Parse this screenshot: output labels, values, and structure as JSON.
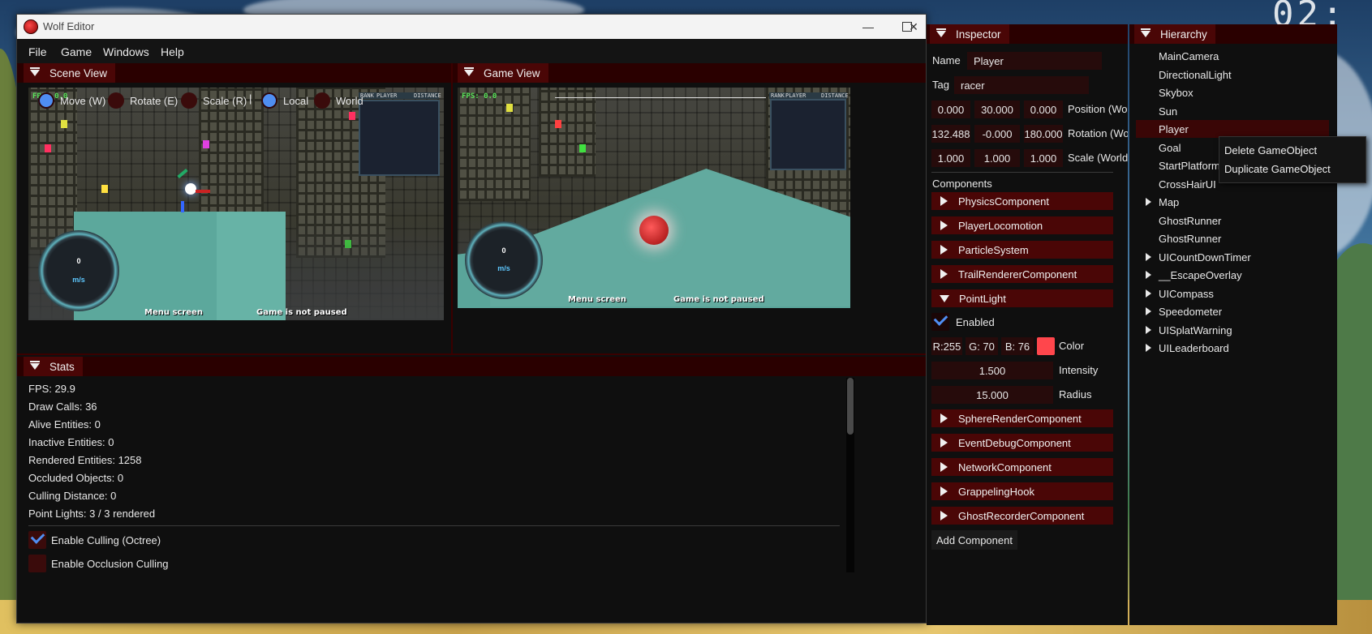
{
  "window": {
    "title": "Wolf Editor"
  },
  "clock": "02:",
  "menu": [
    "File",
    "Game",
    "Windows",
    "Help"
  ],
  "scene_view": {
    "title": "Scene View",
    "gizmo": [
      {
        "label": "Move (W)",
        "active": true
      },
      {
        "label": "Rotate (E)",
        "active": false
      },
      {
        "label": "Scale (R)",
        "active": false
      },
      {
        "label": "Local",
        "active": true
      },
      {
        "label": "World",
        "active": false
      }
    ],
    "separator": "|",
    "hud": {
      "fps": "FPS: 0.0",
      "rank": "RANK",
      "player": "PLAYER",
      "distance": "DISTANCE",
      "speed": "0",
      "unit": "m/s",
      "menu": "Menu screen",
      "paused": "Game is not paused"
    }
  },
  "game_view": {
    "title": "Game View",
    "hud": {
      "fps": "FPS: 0.0",
      "rank": "RANK",
      "player": "PLAYER",
      "distance": "DISTANCE",
      "speed": "0",
      "unit": "m/s",
      "menu": "Menu screen",
      "paused": "Game is not paused"
    }
  },
  "stats": {
    "title": "Stats",
    "lines": [
      "FPS: 29.9",
      "Draw Calls: 36",
      "Alive Entities: 0",
      "Inactive Entities: 0",
      "Rendered Entities: 1258",
      "Occluded Objects: 0",
      "Culling Distance: 0",
      "Point Lights: 3 / 3 rendered"
    ],
    "enable_culling": {
      "label": "Enable Culling (Octree)",
      "checked": true
    },
    "enable_occlusion": {
      "label": "Enable Occlusion Culling",
      "checked": false
    }
  },
  "inspector": {
    "title": "Inspector",
    "name_label": "Name",
    "name_value": "Player",
    "tag_label": "Tag",
    "tag_value": "racer",
    "position": {
      "x": "0.000",
      "y": "30.000",
      "z": "0.000",
      "label": "Position (World)"
    },
    "rotation": {
      "x": "132.488",
      "y": "-0.000",
      "z": "180.000",
      "label": "Rotation (World)"
    },
    "scale": {
      "x": "1.000",
      "y": "1.000",
      "z": "1.000",
      "label": "Scale (World)"
    },
    "components_label": "Components",
    "components_before": [
      "PhysicsComponent",
      "PlayerLocomotion",
      "ParticleSystem",
      "TrailRendererComponent"
    ],
    "point_light": {
      "name": "PointLight",
      "enabled_label": "Enabled",
      "enabled": true,
      "r": "R:255",
      "g": "G: 70",
      "b": "B: 76",
      "color_label": "Color",
      "color_hex": "#ff464c",
      "intensity": "1.500",
      "intensity_label": "Intensity",
      "radius": "15.000",
      "radius_label": "Radius"
    },
    "components_after": [
      "SphereRenderComponent",
      "EventDebugComponent",
      "NetworkComponent",
      "GrappelingHook",
      "GhostRecorderComponent"
    ],
    "add_component": "Add Component"
  },
  "hierarchy": {
    "title": "Hierarchy",
    "items": [
      {
        "label": "MainCamera",
        "expandable": false
      },
      {
        "label": "DirectionalLight",
        "expandable": false
      },
      {
        "label": "Skybox",
        "expandable": false
      },
      {
        "label": "Sun",
        "expandable": false
      },
      {
        "label": "Player",
        "expandable": false,
        "selected": true
      },
      {
        "label": "Goal",
        "expandable": false
      },
      {
        "label": "StartPlatform",
        "expandable": false
      },
      {
        "label": "CrossHairUI",
        "expandable": false
      },
      {
        "label": "Map",
        "expandable": true
      },
      {
        "label": "GhostRunner",
        "expandable": false
      },
      {
        "label": "GhostRunner",
        "expandable": false
      },
      {
        "label": "UICountDownTimer",
        "expandable": true
      },
      {
        "label": "__EscapeOverlay",
        "expandable": true
      },
      {
        "label": "UICompass",
        "expandable": true
      },
      {
        "label": "Speedometer",
        "expandable": true
      },
      {
        "label": "UISplatWarning",
        "expandable": true
      },
      {
        "label": "UILeaderboard",
        "expandable": true
      }
    ],
    "context_menu": [
      "Delete GameObject",
      "Duplicate GameObject"
    ]
  },
  "colors": {
    "accent": "#4a0606",
    "panel_bg": "#0f0f0f",
    "field_bg": "#260b0b",
    "check": "#4f8ef2"
  }
}
